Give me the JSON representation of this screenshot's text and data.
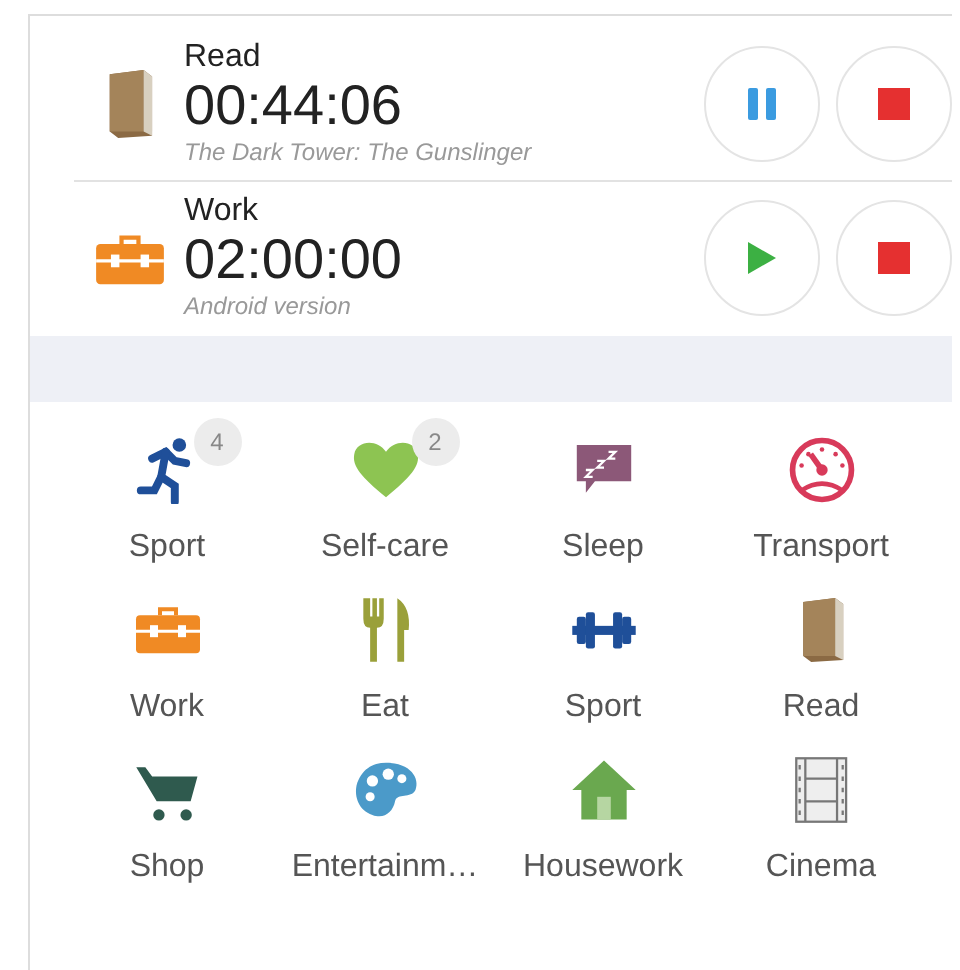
{
  "timers": [
    {
      "kind": "book",
      "title": "Read",
      "time": "00:44:06",
      "note": "The Dark Tower: The Gunslinger",
      "running": true
    },
    {
      "kind": "toolbox",
      "title": "Work",
      "time": "02:00:00",
      "note": "Android version",
      "running": false
    }
  ],
  "categories": [
    {
      "kind": "runner",
      "label": "Sport",
      "badge": "4"
    },
    {
      "kind": "heart",
      "label": "Self-care",
      "badge": "2"
    },
    {
      "kind": "sleep",
      "label": "Sleep"
    },
    {
      "kind": "gauge",
      "label": "Transport"
    },
    {
      "kind": "toolbox",
      "label": "Work"
    },
    {
      "kind": "cutlery",
      "label": "Eat"
    },
    {
      "kind": "dumbbell",
      "label": "Sport"
    },
    {
      "kind": "book",
      "label": "Read"
    },
    {
      "kind": "cart",
      "label": "Shop"
    },
    {
      "kind": "palette",
      "label": "Entertainm…"
    },
    {
      "kind": "house",
      "label": "Housework"
    },
    {
      "kind": "film",
      "label": "Cinema"
    }
  ]
}
